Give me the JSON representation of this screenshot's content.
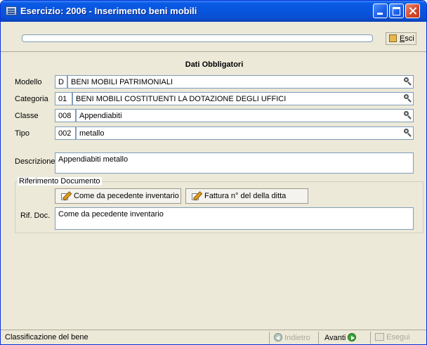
{
  "window": {
    "title": "Esercizio: 2006 - Inserimento beni mobili"
  },
  "toolbar": {
    "esci_prefix": "",
    "esci_underlined": "E",
    "esci_rest": "sci"
  },
  "section": {
    "title": "Dati Obbligatori"
  },
  "fields": {
    "modello": {
      "label": "Modello",
      "code": "D",
      "value": "BENI MOBILI PATRIMONIALI"
    },
    "categoria": {
      "label": "Categoria",
      "code": "01",
      "value": "BENI MOBILI COSTITUENTI LA DOTAZIONE DEGLI UFFICI"
    },
    "classe": {
      "label": "Classe",
      "code": "008",
      "value": "Appendiabiti"
    },
    "tipo": {
      "label": "Tipo",
      "code": "002",
      "value": "metallo"
    },
    "descrizione": {
      "label": "Descrizione",
      "value": "Appendiabiti metallo"
    }
  },
  "riferimento": {
    "legend": "Riferimento Documento",
    "btn_inventario": "Come da pecedente inventario",
    "btn_fattura": "Fattura n° del della ditta",
    "rif_label": "Rif. Doc.",
    "rif_value": "Come da pecedente inventario"
  },
  "status": {
    "text": "Classificazione del bene",
    "back_label": "Indietro",
    "next_label": "Avanti",
    "exec_label": "Esegui"
  }
}
